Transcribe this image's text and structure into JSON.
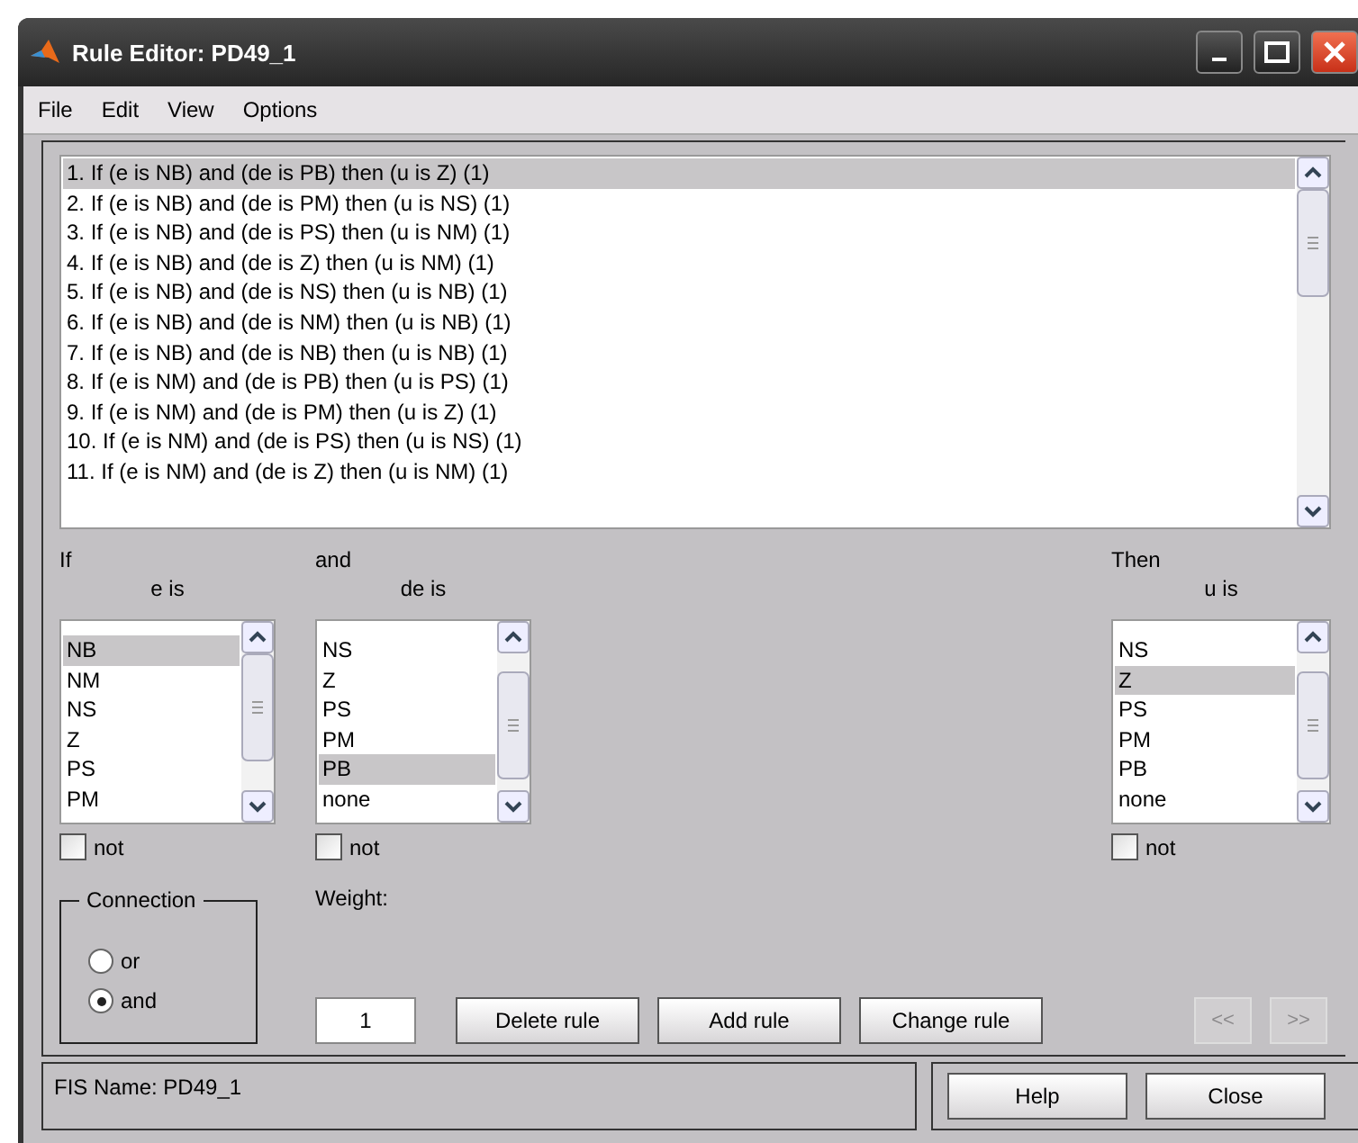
{
  "window": {
    "title": "Rule Editor: PD49_1"
  },
  "menu": [
    "File",
    "Edit",
    "View",
    "Options"
  ],
  "rules": [
    {
      "text": "1. If (e is NB) and (de is PB) then (u is Z) (1)",
      "selected": true
    },
    {
      "text": "2. If (e is NB) and (de is PM) then (u is NS) (1)",
      "selected": false
    },
    {
      "text": "3. If (e is NB) and (de is PS) then (u is NM) (1)",
      "selected": false
    },
    {
      "text": "4. If (e is NB) and (de is Z) then (u is NM) (1)",
      "selected": false
    },
    {
      "text": "5. If (e is NB) and (de is NS) then (u is NB) (1)",
      "selected": false
    },
    {
      "text": "6. If (e is NB) and (de is NM) then (u is NB) (1)",
      "selected": false
    },
    {
      "text": "7. If (e is NB) and (de is NB) then (u is NB) (1)",
      "selected": false
    },
    {
      "text": "8. If (e is NM) and (de is PB) then (u is PS) (1)",
      "selected": false
    },
    {
      "text": "9. If (e is NM) and (de is PM) then (u is Z) (1)",
      "selected": false
    },
    {
      "text": "10. If (e is NM) and (de is PS) then (u is NS) (1)",
      "selected": false
    },
    {
      "text": "11. If (e is NM) and (de is Z) then (u is NM) (1)",
      "selected": false
    }
  ],
  "variables": [
    {
      "section": "If",
      "name": "e is",
      "items": [
        {
          "label": "NB",
          "selected": true
        },
        {
          "label": "NM",
          "selected": false
        },
        {
          "label": "NS",
          "selected": false
        },
        {
          "label": "Z",
          "selected": false
        },
        {
          "label": "PS",
          "selected": false
        },
        {
          "label": "PM",
          "selected": false
        }
      ],
      "not_label": "not",
      "negated": false
    },
    {
      "section": "and",
      "name": "de is",
      "items": [
        {
          "label": "NS",
          "selected": false
        },
        {
          "label": "Z",
          "selected": false
        },
        {
          "label": "PS",
          "selected": false
        },
        {
          "label": "PM",
          "selected": false
        },
        {
          "label": "PB",
          "selected": true
        },
        {
          "label": "none",
          "selected": false
        }
      ],
      "not_label": "not",
      "negated": false
    },
    {
      "section": "Then",
      "name": "u is",
      "items": [
        {
          "label": "NS",
          "selected": false
        },
        {
          "label": "Z",
          "selected": true
        },
        {
          "label": "PS",
          "selected": false
        },
        {
          "label": "PM",
          "selected": false
        },
        {
          "label": "PB",
          "selected": false
        },
        {
          "label": "none",
          "selected": false
        }
      ],
      "not_label": "not",
      "negated": false
    }
  ],
  "connection": {
    "title": "Connection",
    "options": [
      {
        "label": "or",
        "selected": false
      },
      {
        "label": "and",
        "selected": true
      }
    ]
  },
  "weight": {
    "label": "Weight:",
    "value": "1"
  },
  "buttons": [
    "Delete rule",
    "Add rule",
    "Change rule"
  ],
  "nav": [
    {
      "label": "<<",
      "disabled": true
    },
    {
      "label": ">>",
      "disabled": true
    }
  ],
  "status": "FIS Name: PD49_1",
  "footer_buttons": [
    "Help",
    "Close"
  ]
}
